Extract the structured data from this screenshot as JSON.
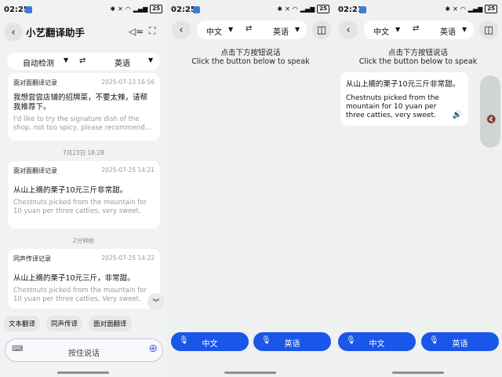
{
  "panel1": {
    "status": {
      "time": "02:25",
      "battery": "25"
    },
    "title": "小艺翻译助手",
    "lang": {
      "source": "自动检测",
      "target": "英语"
    },
    "records": [
      {
        "type": "面对面翻译记录",
        "date": "2025-07-23 16:56",
        "source": "我想尝尝店铺的招牌菜，不要太辣，请帮我推荐下。",
        "target": "I'd like to try the signature dish of the shop, not too spicy, please recommend..."
      },
      {
        "type": "面对面翻译记录",
        "date": "2025-07-25 14:21",
        "source": "从山上摘的栗子10元三斤非常甜。",
        "target": "Chestnuts picked from the mountain for 10 yuan per three catties, very sweet."
      },
      {
        "type": "同声传译记录",
        "date": "2025-07-25 14:22",
        "source": "从山上摘的栗子10元三斤，非常甜。",
        "target": "Chestnuts picked from the mountain for 10 yuan per three catties, Very sweet."
      }
    ],
    "separators": [
      "7月23日 18:28",
      "2分钟前"
    ],
    "chips": [
      "文本翻译",
      "同声传译",
      "面对面翻译"
    ],
    "input_placeholder": "按住说话"
  },
  "panel2": {
    "status": {
      "time": "02:25",
      "battery": "25"
    },
    "lang": {
      "source": "中文",
      "target": "英语"
    },
    "hint_cn": "点击下方按钮说话",
    "hint_en": "Click the button below to speak",
    "btn_left": "中文",
    "btn_right": "英语"
  },
  "panel3": {
    "status": {
      "time": "02:21",
      "battery": "25"
    },
    "lang": {
      "source": "中文",
      "target": "英语"
    },
    "hint_cn": "点击下方按钮说话",
    "hint_en": "Click the button below to speak",
    "result_source": "从山上摘的栗子10元三斤非常甜。",
    "result_target": "Chestnuts picked from the mountain for 10 yuan per three catties, very sweet.",
    "btn_left": "中文",
    "btn_right": "英语"
  },
  "colors": {
    "accent_blue": "#1a56e8",
    "background": "#eef1f0"
  }
}
